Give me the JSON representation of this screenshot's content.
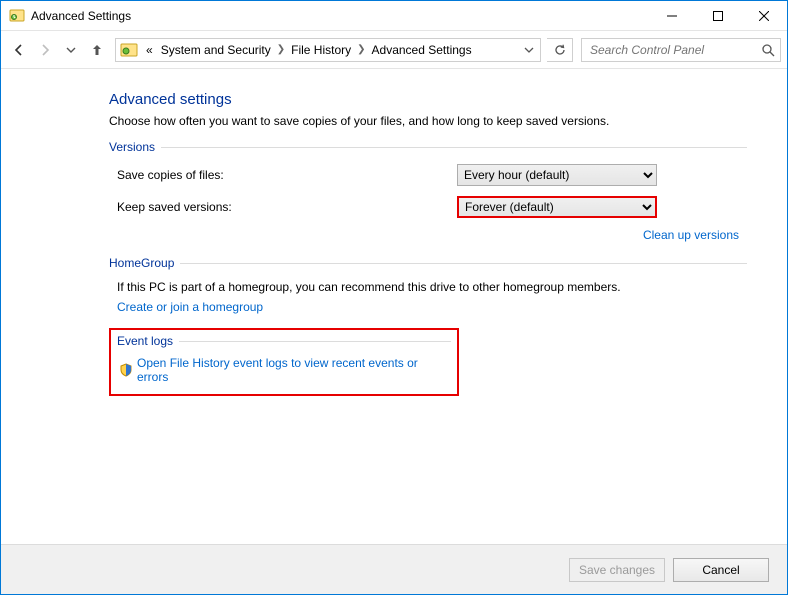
{
  "window": {
    "title": "Advanced Settings"
  },
  "breadcrumb": {
    "prefix": "«",
    "items": [
      "System and Security",
      "File History",
      "Advanced Settings"
    ]
  },
  "search": {
    "placeholder": "Search Control Panel"
  },
  "page": {
    "heading": "Advanced settings",
    "description": "Choose how often you want to save copies of your files, and how long to keep saved versions."
  },
  "versions": {
    "group_label": "Versions",
    "save_label": "Save copies of files:",
    "save_value": "Every hour (default)",
    "keep_label": "Keep saved versions:",
    "keep_value": "Forever (default)",
    "cleanup_link": "Clean up versions"
  },
  "homegroup": {
    "group_label": "HomeGroup",
    "text": "If this PC is part of a homegroup, you can recommend this drive to other homegroup members.",
    "link": "Create or join a homegroup"
  },
  "eventlogs": {
    "group_label": "Event logs",
    "link": "Open File History event logs to view recent events or errors"
  },
  "footer": {
    "save_label": "Save changes",
    "cancel_label": "Cancel"
  }
}
